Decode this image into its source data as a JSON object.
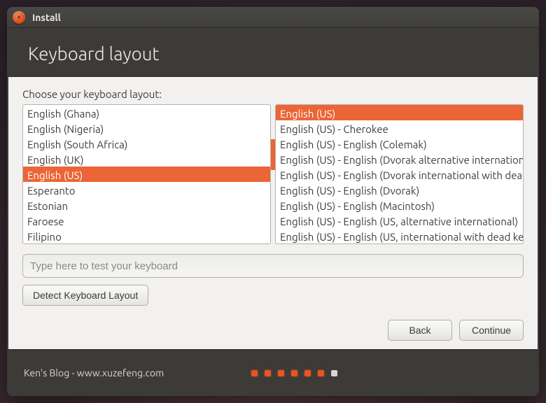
{
  "window": {
    "title": "Install",
    "close_glyph": "×"
  },
  "header": {
    "title": "Keyboard layout"
  },
  "label": "Choose your keyboard layout:",
  "left_list": [
    {
      "label": "English (Ghana)",
      "selected": false
    },
    {
      "label": "English (Nigeria)",
      "selected": false
    },
    {
      "label": "English (South Africa)",
      "selected": false
    },
    {
      "label": "English (UK)",
      "selected": false
    },
    {
      "label": "English (US)",
      "selected": true
    },
    {
      "label": "Esperanto",
      "selected": false
    },
    {
      "label": "Estonian",
      "selected": false
    },
    {
      "label": "Faroese",
      "selected": false
    },
    {
      "label": "Filipino",
      "selected": false
    }
  ],
  "right_list": [
    {
      "label": "English (US)",
      "selected": true
    },
    {
      "label": "English (US) - Cherokee",
      "selected": false
    },
    {
      "label": "English (US) - English (Colemak)",
      "selected": false
    },
    {
      "label": "English (US) - English (Dvorak alternative international",
      "selected": false
    },
    {
      "label": "English (US) - English (Dvorak international with dead",
      "selected": false
    },
    {
      "label": "English (US) - English (Dvorak)",
      "selected": false
    },
    {
      "label": "English (US) - English (Macintosh)",
      "selected": false
    },
    {
      "label": "English (US) - English (US, alternative international)",
      "selected": false
    },
    {
      "label": "English (US) - English (US, international with dead key",
      "selected": false
    }
  ],
  "test_placeholder": "Type here to test your keyboard",
  "detect_label": "Detect Keyboard Layout",
  "nav": {
    "back": "Back",
    "continue": "Continue"
  },
  "footer": {
    "text": "Ken's Blog - www.xuzefeng.com",
    "steps": {
      "total": 7,
      "current": 6
    }
  },
  "colors": {
    "accent": "#eb6536"
  }
}
